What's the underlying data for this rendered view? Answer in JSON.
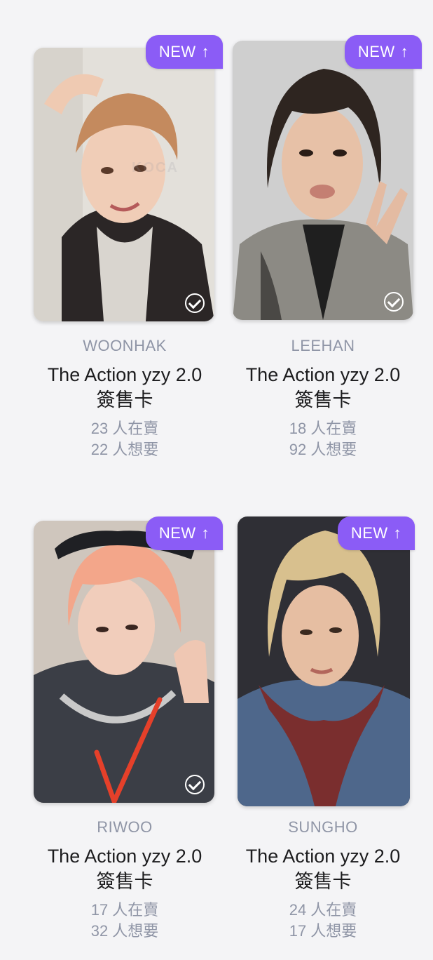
{
  "cards": [
    {
      "badge": "NEW",
      "member": "WOONHAK",
      "title_line1": "The Action yzy 2.0",
      "title_line2": "簽售卡",
      "selling": "23 人在賣",
      "wanting": "22 人想要",
      "checked": true,
      "photo_palette": {
        "bg": "#e3e0da",
        "hair": "#c48a5e",
        "skin": "#f0cdb7",
        "cloth": "#2b2626"
      }
    },
    {
      "badge": "NEW",
      "member": "LEEHAN",
      "title_line1": "The Action yzy 2.0",
      "title_line2": "簽售卡",
      "selling": "18 人在賣",
      "wanting": "92 人想要",
      "checked": true,
      "photo_palette": {
        "bg": "#cfcfcf",
        "hair": "#2e2520",
        "skin": "#e7c1a7",
        "cloth": "#8c8a84"
      }
    },
    {
      "badge": "NEW",
      "member": "RIWOO",
      "title_line1": "The Action yzy 2.0",
      "title_line2": "簽售卡",
      "selling": "17 人在賣",
      "wanting": "32 人想要",
      "checked": true,
      "photo_palette": {
        "bg": "#cfc6bd",
        "hair": "#f3a68a",
        "skin": "#f1cdbb",
        "cloth": "#3b3e46"
      }
    },
    {
      "badge": "NEW",
      "member": "SUNGHO",
      "title_line1": "The Action yzy 2.0",
      "title_line2": "簽售卡",
      "selling": "24 人在賣",
      "wanting": "17 人想要",
      "checked": false,
      "photo_palette": {
        "bg": "#2f2f35",
        "hair": "#d8c08e",
        "skin": "#e6bea2",
        "cloth": "#4e678b"
      }
    }
  ],
  "colors": {
    "accent": "#8b5cf6",
    "muted_text": "#8f95a6",
    "body_text": "#1c1c1e",
    "background": "#f4f4f6"
  }
}
